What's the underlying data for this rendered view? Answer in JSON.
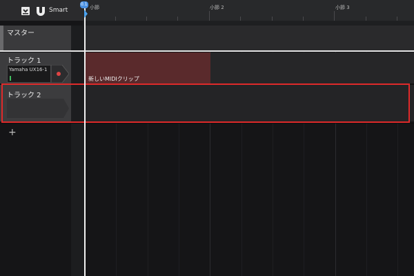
{
  "toolbar": {
    "smart_label": "Smart"
  },
  "ruler": {
    "playhead_label": "0.1",
    "bars": [
      "小節",
      "小節 2",
      "小節 3"
    ]
  },
  "tracks": {
    "master": {
      "name": "マスター"
    },
    "track1": {
      "name": "トラック 1",
      "device": "Yamaha UX16-1"
    },
    "track2": {
      "name": "トラック 2"
    }
  },
  "clip": {
    "label": "新しいMIDIクリップ"
  },
  "colors": {
    "clip": "#5a2a2c",
    "selection": "#e02a2a",
    "playhead": "#f2f2f2",
    "meter": "#3fbf5f"
  }
}
